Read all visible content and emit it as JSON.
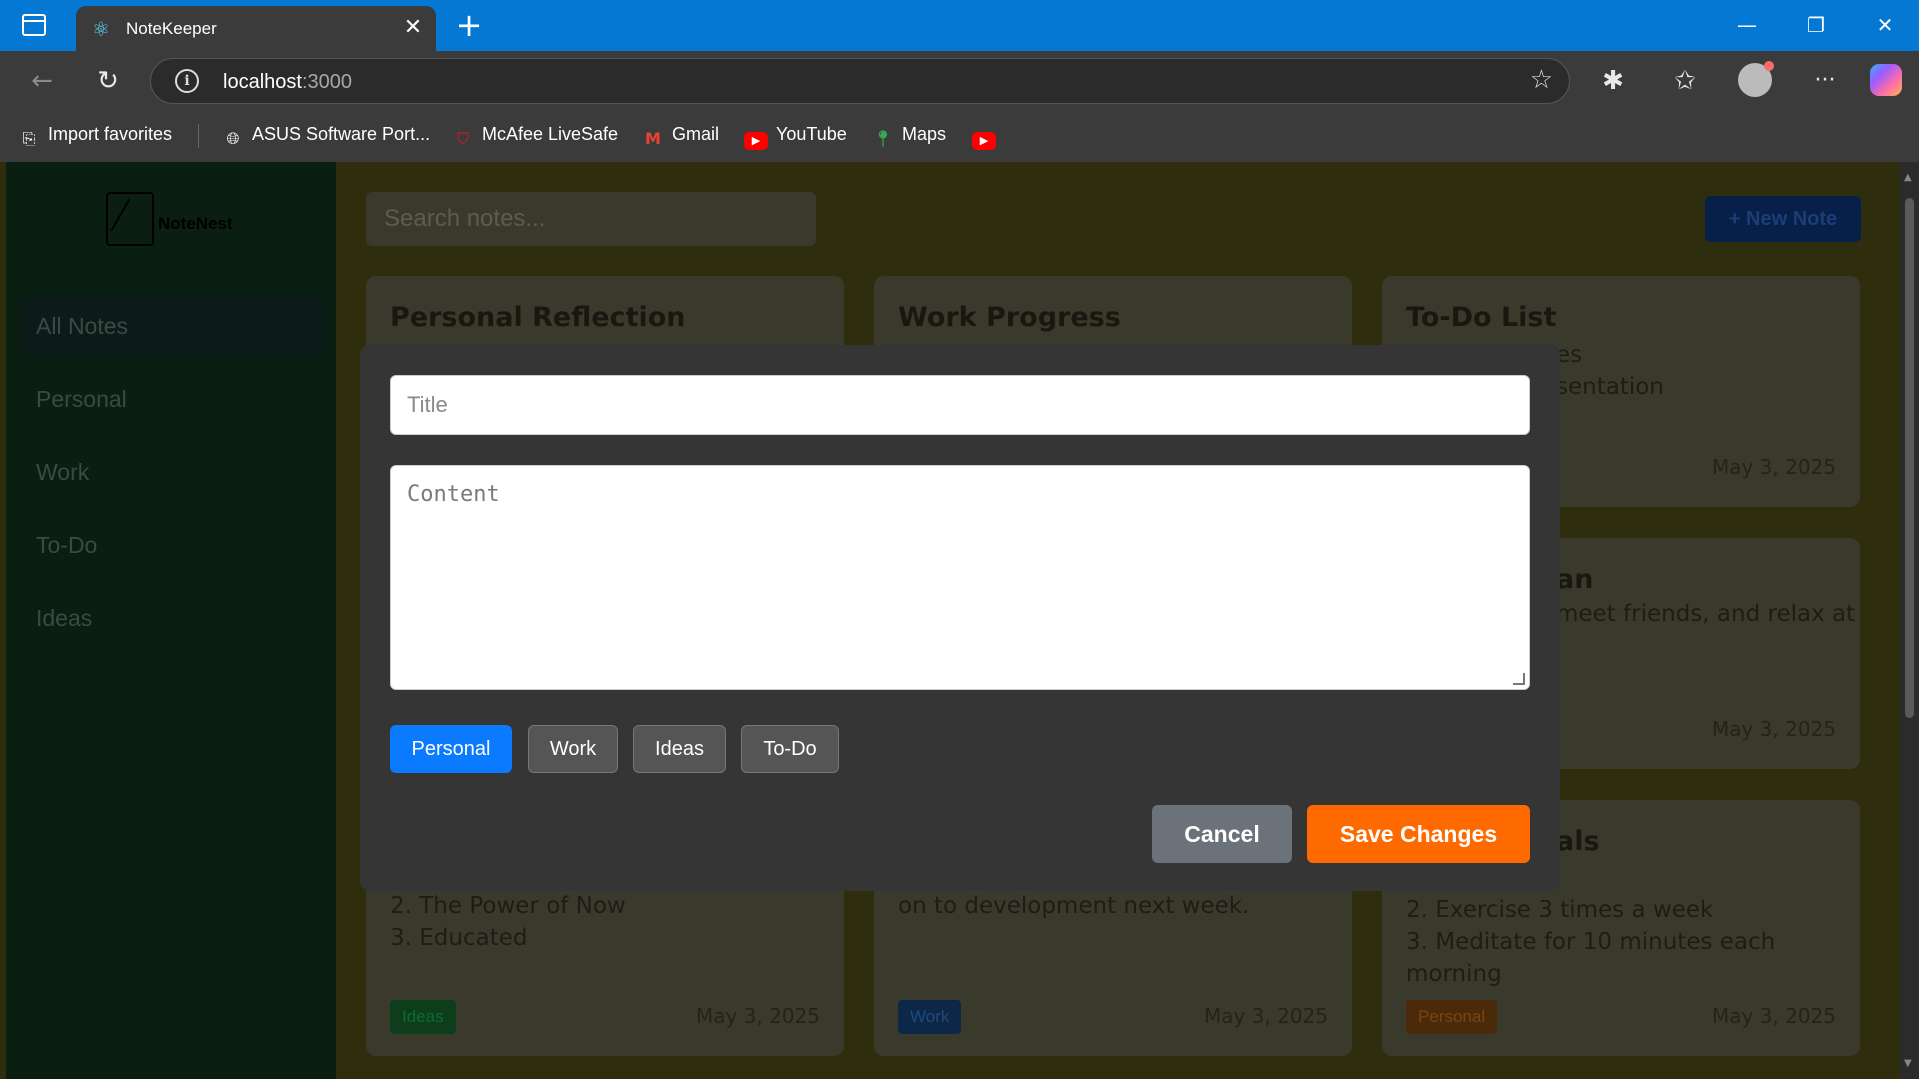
{
  "browser": {
    "tab_title": "NoteKeeper",
    "tab_close": "✕",
    "new_tab": "+",
    "win_min": "—",
    "win_restore": "❐",
    "win_close": "✕",
    "back": "←",
    "reload": "↻",
    "info": "i",
    "url_host": "localhost",
    "url_port": ":3000",
    "star": "☆",
    "extensions": "✱",
    "favorites": "✩",
    "more": "···",
    "bookmarks": [
      {
        "label": "Import favorites",
        "icon": "import-icon"
      },
      {
        "label": "ASUS Software Port...",
        "icon": "globe-icon"
      },
      {
        "label": "McAfee LiveSafe",
        "icon": "mcafee-icon"
      },
      {
        "label": "Gmail",
        "icon": "gmail-icon"
      },
      {
        "label": "YouTube",
        "icon": "youtube-icon"
      },
      {
        "label": "Maps",
        "icon": "maps-icon"
      },
      {
        "label": "",
        "icon": "youtube-icon"
      }
    ]
  },
  "app": {
    "logo_text": "NoteNest",
    "nav": [
      "All Notes",
      "Personal",
      "Work",
      "To-Do",
      "Ideas"
    ],
    "search_placeholder": "Search notes...",
    "new_note": "+ New Note",
    "cards": [
      {
        "title": "Personal Reflection",
        "body": "2. The Power of Now\n3. Educated",
        "tag": "Ideas",
        "date": "May 3, 2025"
      },
      {
        "title": "Work Progress",
        "body": "on to development next week.",
        "tag": "Work",
        "date": "May 3, 2025"
      },
      {
        "title": "To-Do List",
        "body": "es\nsentation",
        "tag": "",
        "date": "May 3, 2025"
      },
      {
        "title": "an",
        "body": "meet friends, and relax at",
        "tag": "",
        "date": "May 3, 2025"
      },
      {
        "title": "als",
        "body": "ges daily\n2. Exercise 3 times a week\n3. Meditate for 10 minutes each morning",
        "tag": "Personal",
        "date": "May 3, 2025"
      }
    ]
  },
  "modal": {
    "title_placeholder": "Title",
    "content_placeholder": "Content",
    "categories": [
      "Personal",
      "Work",
      "Ideas",
      "To-Do"
    ],
    "selected_category": "Personal",
    "cancel": "Cancel",
    "save": "Save Changes"
  },
  "colors": {
    "accent_blue": "#0a7aff",
    "save_orange": "#ff6a00",
    "titlebar": "#0578d4"
  }
}
